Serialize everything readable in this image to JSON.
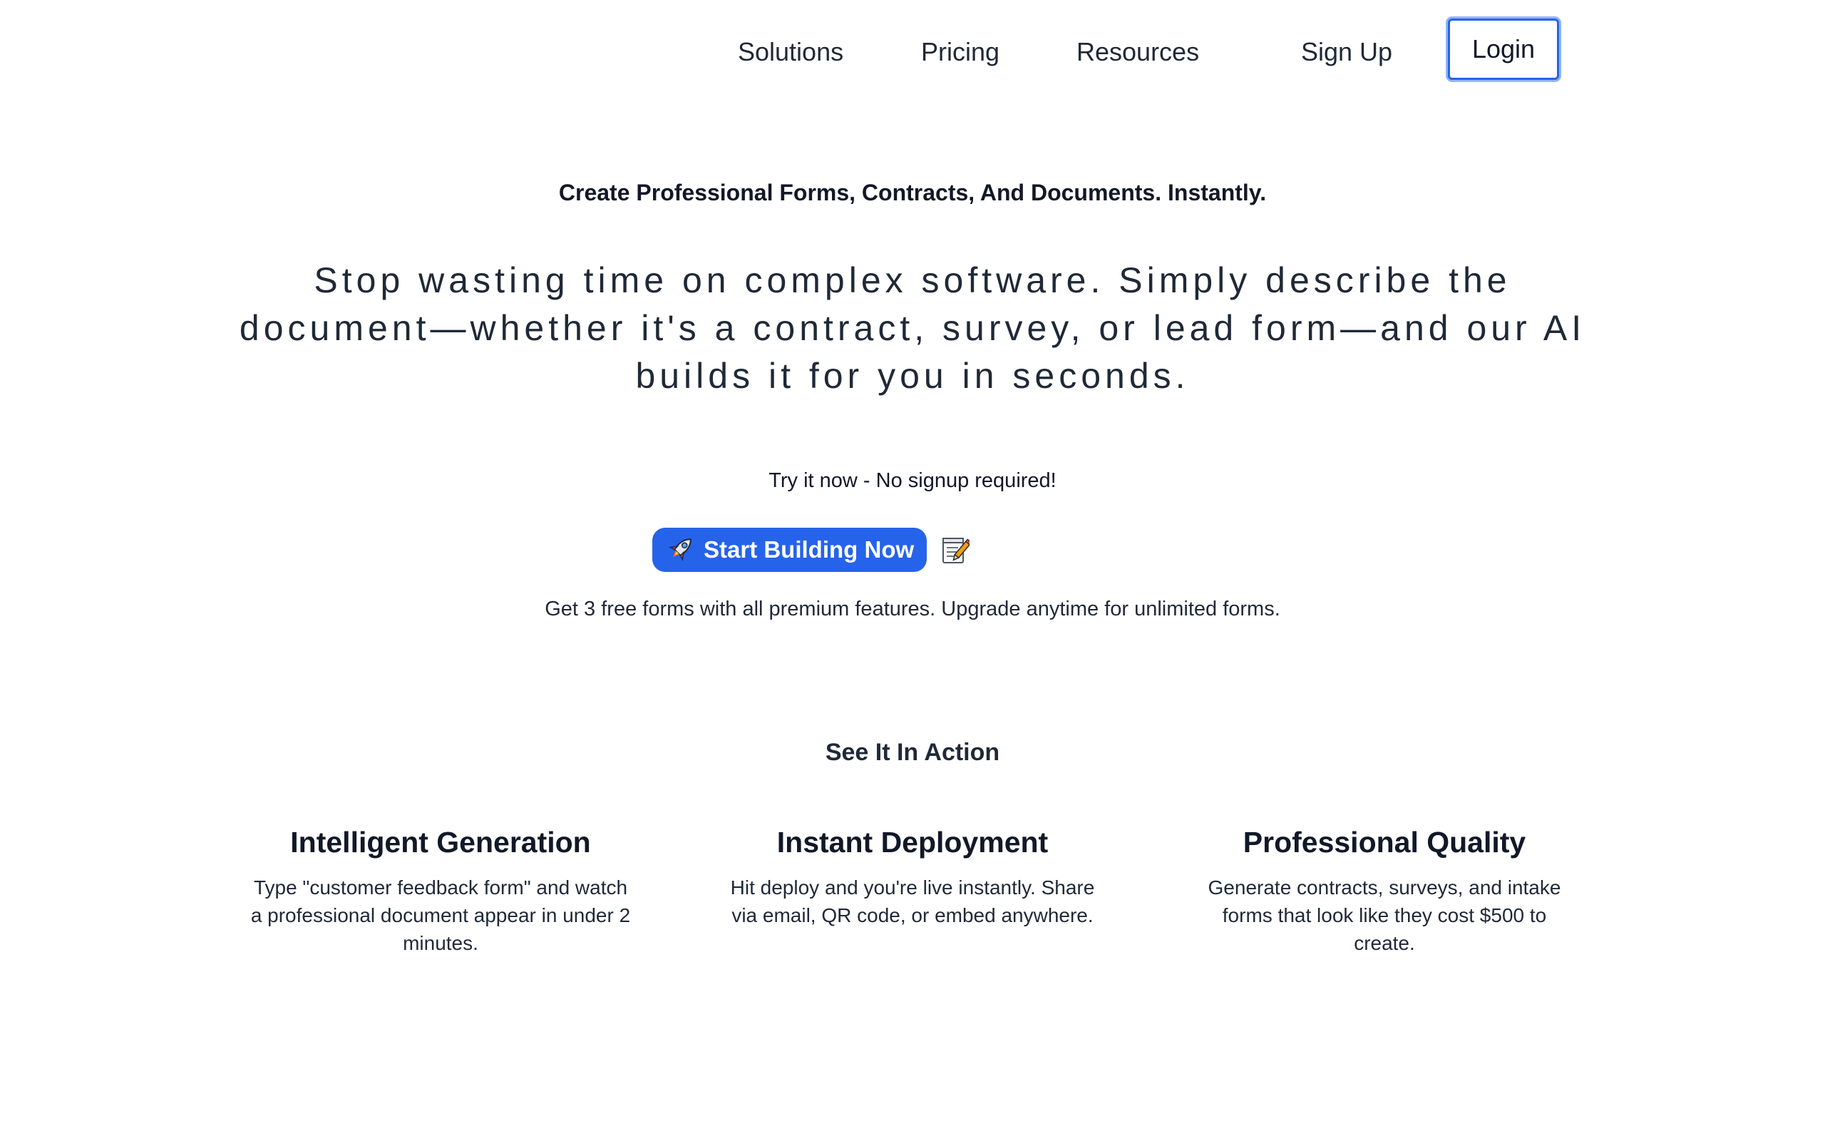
{
  "nav": {
    "solutions": "Solutions",
    "pricing": "Pricing",
    "resources": "Resources",
    "sign_up": "Sign Up",
    "login": "Login"
  },
  "hero": {
    "title": "Create Professional Forms, Contracts, And Documents. Instantly.",
    "subtitle": "Stop wasting time on complex software. Simply describe the document—whether it's a contract, survey, or lead form—and our AI builds it for you in seconds.",
    "try_text": "Try it now - No signup required!",
    "cta_label": "Start Building Now",
    "free_text": "Get 3 free forms with all premium features. Upgrade anytime for unlimited forms."
  },
  "icons": {
    "cta_icon": "rocket-icon",
    "trailing_icon": "memo-icon"
  },
  "colors": {
    "accent": "#2563eb",
    "text": "#1f2937",
    "background": "#ffffff"
  },
  "action": {
    "heading": "See It In Action",
    "features": [
      {
        "title": "Intelligent Generation",
        "description": "Type \"customer feedback form\" and watch a professional document appear in under 2 minutes."
      },
      {
        "title": "Instant Deployment",
        "description": "Hit deploy and you're live instantly. Share via email, QR code, or embed anywhere."
      },
      {
        "title": "Professional Quality",
        "description": "Generate contracts, surveys, and intake forms that look like they cost $500 to create."
      }
    ]
  }
}
